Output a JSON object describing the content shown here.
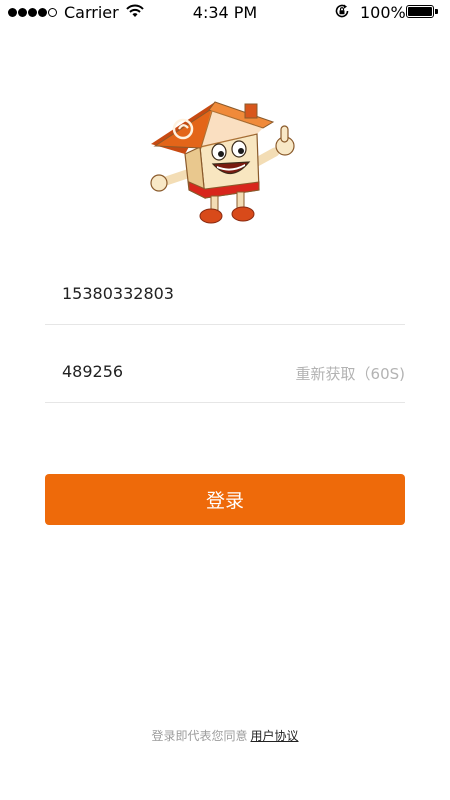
{
  "status_bar": {
    "carrier": "Carrier",
    "time": "4:34 PM",
    "battery": "100%",
    "signal_icon": "signal-dots-icon",
    "wifi_icon": "wifi-icon",
    "rotation_icon": "rotation-lock-icon",
    "battery_icon": "battery-icon"
  },
  "mascot": {
    "icon": "house-mascot-icon"
  },
  "form": {
    "phone_value": "15380332803",
    "code_value": "489256",
    "resend_label": "重新获取（60S)",
    "login_label": "登录"
  },
  "footer": {
    "agreement_text": "登录即代表您同意",
    "agreement_link": "用户协议"
  },
  "colors": {
    "accent": "#ee6a0a",
    "divider": "#e6e6e6",
    "muted_text": "#b3b3b3",
    "footer_text": "#9c9c9c"
  }
}
